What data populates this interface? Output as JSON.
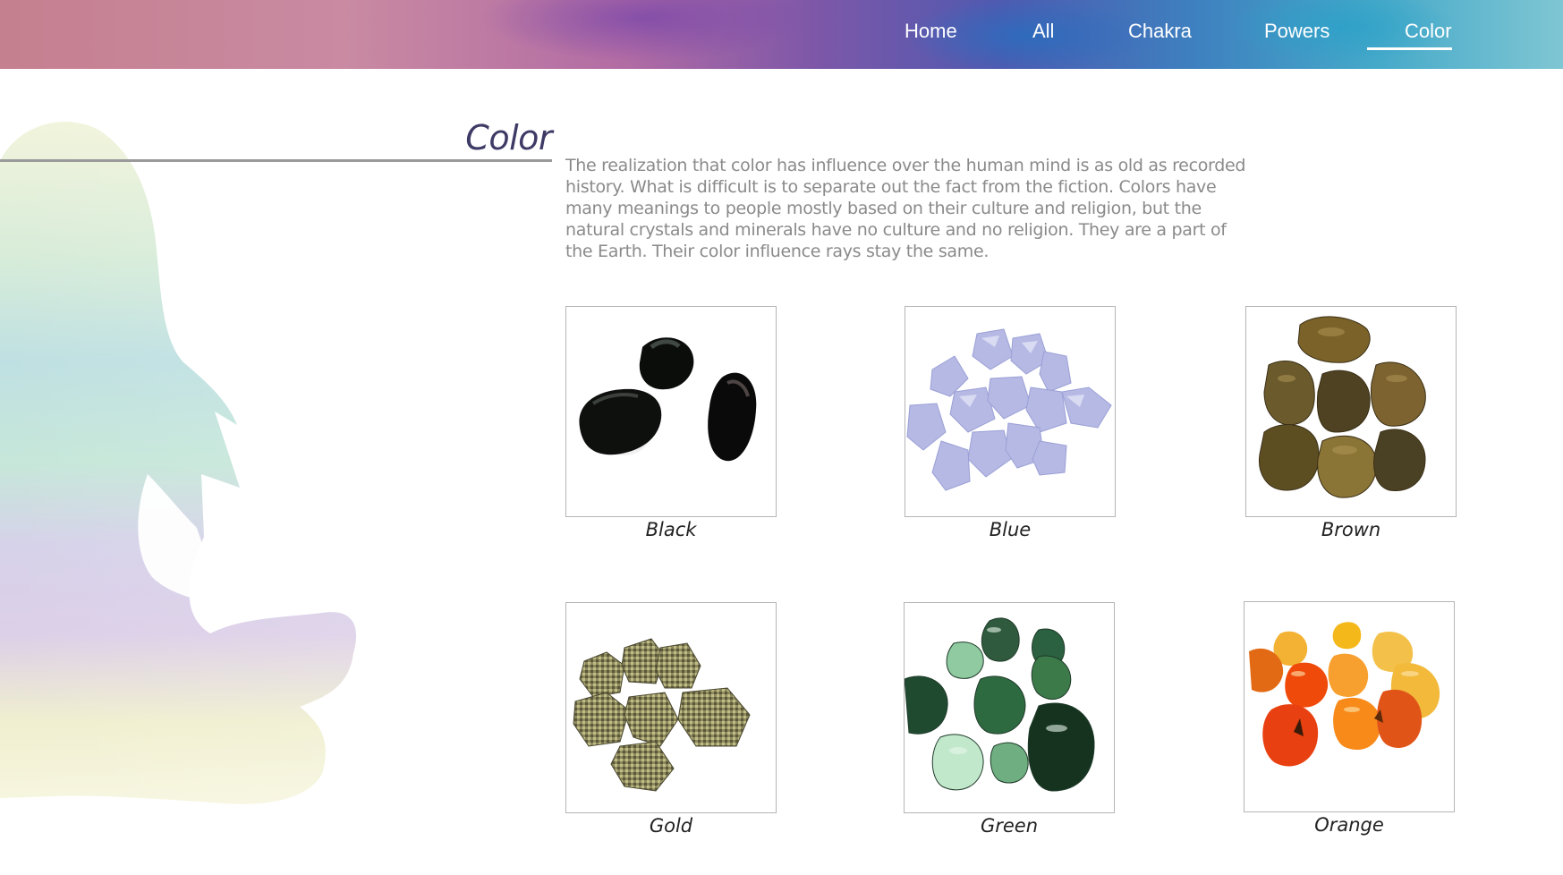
{
  "nav": {
    "items": [
      {
        "label": "Home"
      },
      {
        "label": "All"
      },
      {
        "label": "Chakra"
      },
      {
        "label": "Powers"
      },
      {
        "label": "Color"
      }
    ],
    "active": "Color"
  },
  "page": {
    "title": "Color",
    "intro": "The realization that color has influence over the human mind is as old as recorded history. What is difficult is to separate out the fact from the fiction. Colors have many meanings to people mostly based on their culture and religion, but the natural crystals and minerals have no culture and no religion. They are a part of the Earth. Their color influence rays stay the same."
  },
  "colors": {
    "nav_text": "#ffffff",
    "title": "#3e3a66",
    "body_text": "#8a8a8a",
    "rule": "#9a9a9a"
  },
  "gallery": [
    {
      "label": "Black",
      "image": "black-stones-image"
    },
    {
      "label": "Blue",
      "image": "blue-stones-image"
    },
    {
      "label": "Brown",
      "image": "brown-stones-image"
    },
    {
      "label": "Gold",
      "image": "gold-stones-image"
    },
    {
      "label": "Green",
      "image": "green-stones-image"
    },
    {
      "label": "Orange",
      "image": "orange-stones-image"
    }
  ]
}
